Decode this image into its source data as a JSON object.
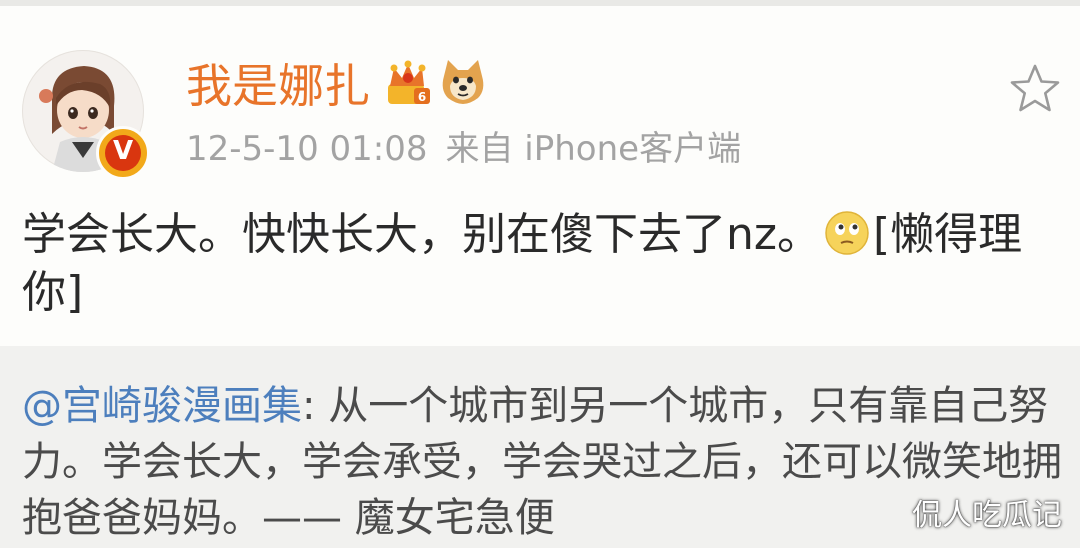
{
  "post": {
    "username": "我是娜扎",
    "timestamp": "12-5-10 01:08",
    "source": "来自 iPhone客户端",
    "text_before_emoji": "学会长大。快快长大，别在傻下去了nz。",
    "text_after_emoji": "[懒得理你]",
    "verified_badge": "V"
  },
  "repost": {
    "mention": "@宫崎骏漫画集",
    "text": ": 从一个城市到另一个城市，只有靠自己努力。学会长大，学会承受，学会哭过之后，还可以微笑地拥抱爸爸妈妈。—— 魔女宅急便"
  },
  "watermark": "侃人吃瓜记",
  "icons": {
    "avatar": "avatar-girl",
    "verified": "verified-v-badge-icon",
    "crown": "vip-crown-icon",
    "doge": "doge-icon",
    "favorite": "star-icon",
    "emoji": "thinking-emoji-icon"
  },
  "colors": {
    "username": "#e8742a",
    "mention": "#4d7fbd",
    "meta": "#a3a3a3",
    "repost_bg": "#f1f1ef"
  }
}
